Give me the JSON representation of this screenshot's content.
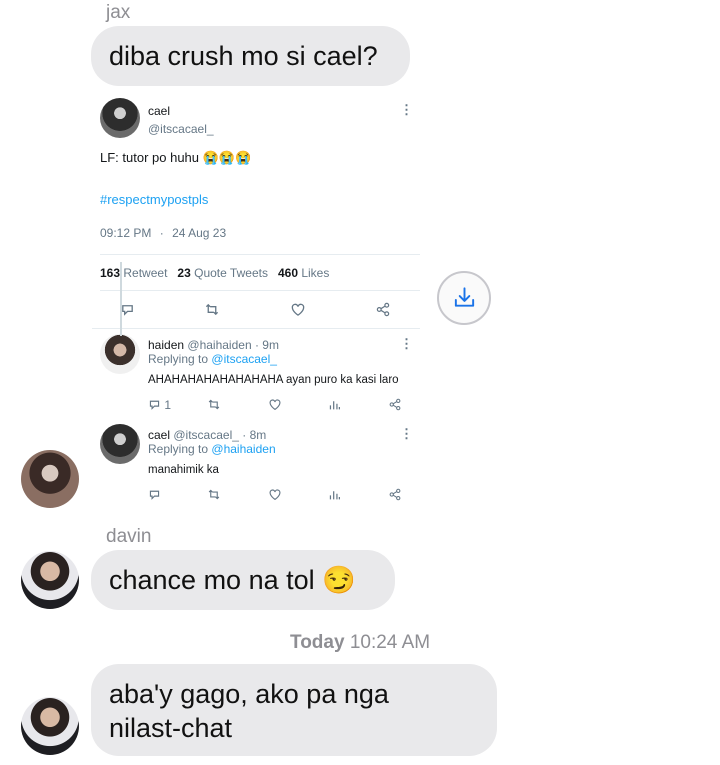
{
  "messages": {
    "jax_name": "jax",
    "jax_text": "diba crush mo si cael?",
    "davin_name": "davin",
    "davin_text": "chance mo na tol 😏",
    "timestamp_day": "Today",
    "timestamp_time": "10:24 AM",
    "last_text_line1": "aba'y gago, ako pa nga",
    "last_text_line2": "nilast-chat"
  },
  "tweet": {
    "author_name": "cael",
    "author_handle": "@itscacael_",
    "body": "LF: tutor po huhu 😭😭😭",
    "hashtag": "#respectmypostpls",
    "time": "09:12 PM",
    "date_sep": "·",
    "date": "24 Aug 23",
    "retweets_count": "163",
    "retweets_label": "Retweet",
    "quotes_count": "23",
    "quotes_label": "Quote Tweets",
    "likes_count": "460",
    "likes_label": "Likes"
  },
  "replies": [
    {
      "name": "haiden",
      "handle": "@haihaiden",
      "age": "· 9m",
      "replying_prefix": "Replying to",
      "replying_to": "@itscacael_",
      "text": "AHAHAHAHAHAHAHAHA ayan puro ka kasi laro",
      "reply_count": "1"
    },
    {
      "name": "cael",
      "handle": "@itscacael_",
      "age": "· 8m",
      "replying_prefix": "Replying to",
      "replying_to": "@haihaiden",
      "text": "manahimik ka"
    }
  ],
  "icons": {
    "more": "more-icon",
    "reply": "reply-icon",
    "retweet": "retweet-icon",
    "like": "heart-icon",
    "share": "share-icon",
    "analytics": "analytics-icon",
    "save": "save-download-icon"
  },
  "colors": {
    "bubble": "#e9e9eb",
    "link": "#1da1f2",
    "meta_gray": "#8e8e93"
  }
}
